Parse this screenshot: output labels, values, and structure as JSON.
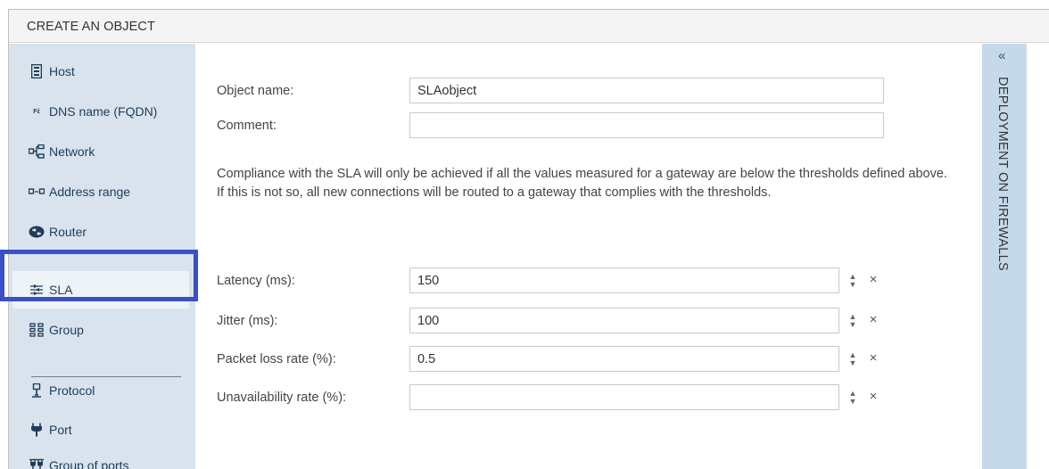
{
  "header": {
    "title": "CREATE AN OBJECT"
  },
  "sidebar": {
    "items": [
      {
        "label": "Host",
        "icon": "host-icon"
      },
      {
        "label": "DNS name (FQDN)",
        "icon": "fqdn-icon"
      },
      {
        "label": "Network",
        "icon": "network-icon"
      },
      {
        "label": "Address range",
        "icon": "address-range-icon"
      },
      {
        "label": "Router",
        "icon": "router-icon"
      },
      {
        "label": "SLA",
        "icon": "sla-icon",
        "active": true
      },
      {
        "label": "Group",
        "icon": "group-icon"
      },
      {
        "label": "Protocol",
        "icon": "protocol-icon"
      },
      {
        "label": "Port",
        "icon": "port-icon"
      },
      {
        "label": "Group of ports",
        "icon": "group-of-ports-icon"
      }
    ]
  },
  "form": {
    "object_name_label": "Object name:",
    "object_name_value": "SLAobject",
    "comment_label": "Comment:",
    "comment_value": "",
    "note": "Compliance with the SLA will only be achieved if all the values measured for a gateway are below the thresholds defined above. If this is not so, all new connections will be routed to a gateway that complies with the thresholds.",
    "latency_label": "Latency (ms):",
    "latency_value": "150",
    "jitter_label": "Jitter (ms):",
    "jitter_value": "100",
    "packet_loss_label": "Packet loss rate (%):",
    "packet_loss_value": "0.5",
    "unavailability_label": "Unavailability rate (%):",
    "unavailability_value": ""
  },
  "right_panel": {
    "chevron": "«",
    "title": "DEPLOYMENT ON FIREWALLS"
  },
  "colors": {
    "sidebar_bg": "#d8e3ed",
    "right_panel_bg": "#c5d9ea",
    "highlight_border": "#3b4fc6"
  }
}
